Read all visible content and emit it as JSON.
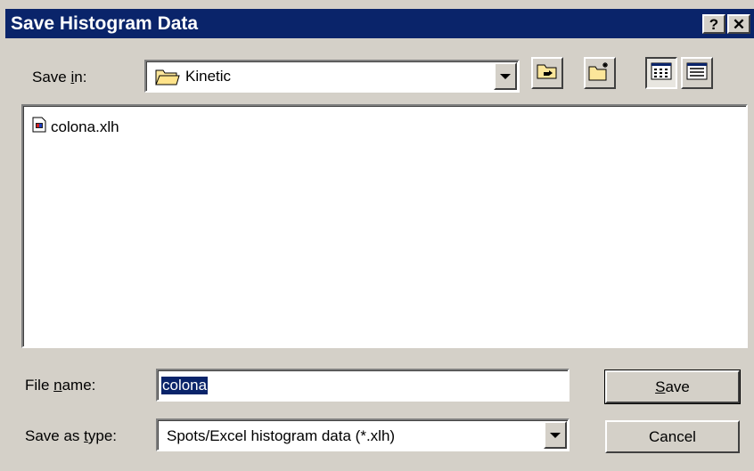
{
  "dialog": {
    "title": "Save Histogram Data",
    "help_label": "?",
    "close_label": "✕"
  },
  "save_in": {
    "label_pre": "Save ",
    "label_accel": "i",
    "label_post": "n:",
    "value": "Kinetic",
    "folder_icon": "folder-icon"
  },
  "toolbar": {
    "up_icon": "up-one-level-icon",
    "new_folder_icon": "new-folder-icon",
    "list_view_icon": "list-view-icon",
    "details_view_icon": "details-view-icon"
  },
  "files": [
    {
      "name": "colona.xlh",
      "icon": "xlh-file-icon"
    }
  ],
  "file_name": {
    "label_pre": "File ",
    "label_accel": "n",
    "label_post": "ame:",
    "value": "colona"
  },
  "save_as_type": {
    "label_pre": "Save as ",
    "label_accel": "t",
    "label_post": "ype:",
    "value": "Spots/Excel histogram data (*.xlh)"
  },
  "buttons": {
    "save_accel": "S",
    "save_rest": "ave",
    "cancel": "Cancel"
  },
  "colors": {
    "titlebar": "#0a246a",
    "face": "#d4d0c8",
    "selection": "#0a246a"
  }
}
